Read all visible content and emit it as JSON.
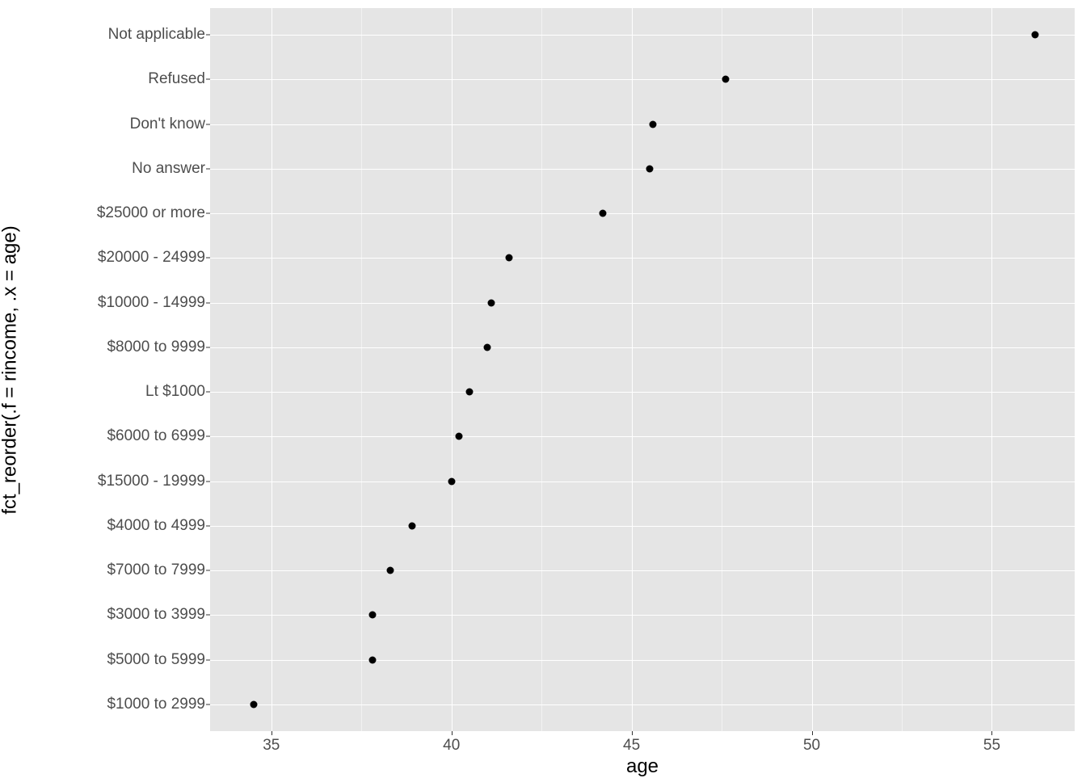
{
  "chart_data": {
    "type": "scatter",
    "xlabel": "age",
    "ylabel": "fct_reorder(.f = rincome, .x = age)",
    "xlim": [
      33.3,
      57.3
    ],
    "x_ticks": [
      35,
      40,
      45,
      50,
      55
    ],
    "categories": [
      "$1000 to 2999",
      "$5000 to 5999",
      "$3000 to 3999",
      "$7000 to 7999",
      "$4000 to 4999",
      "$15000 - 19999",
      "$6000 to 6999",
      "Lt $1000",
      "$8000 to 9999",
      "$10000 - 14999",
      "$20000 - 24999",
      "$25000 or more",
      "No answer",
      "Don't know",
      "Refused",
      "Not applicable"
    ],
    "values": [
      34.5,
      37.8,
      37.8,
      38.3,
      38.9,
      40.0,
      40.2,
      40.5,
      41.0,
      41.1,
      41.6,
      44.2,
      45.5,
      45.6,
      47.6,
      56.2
    ]
  }
}
